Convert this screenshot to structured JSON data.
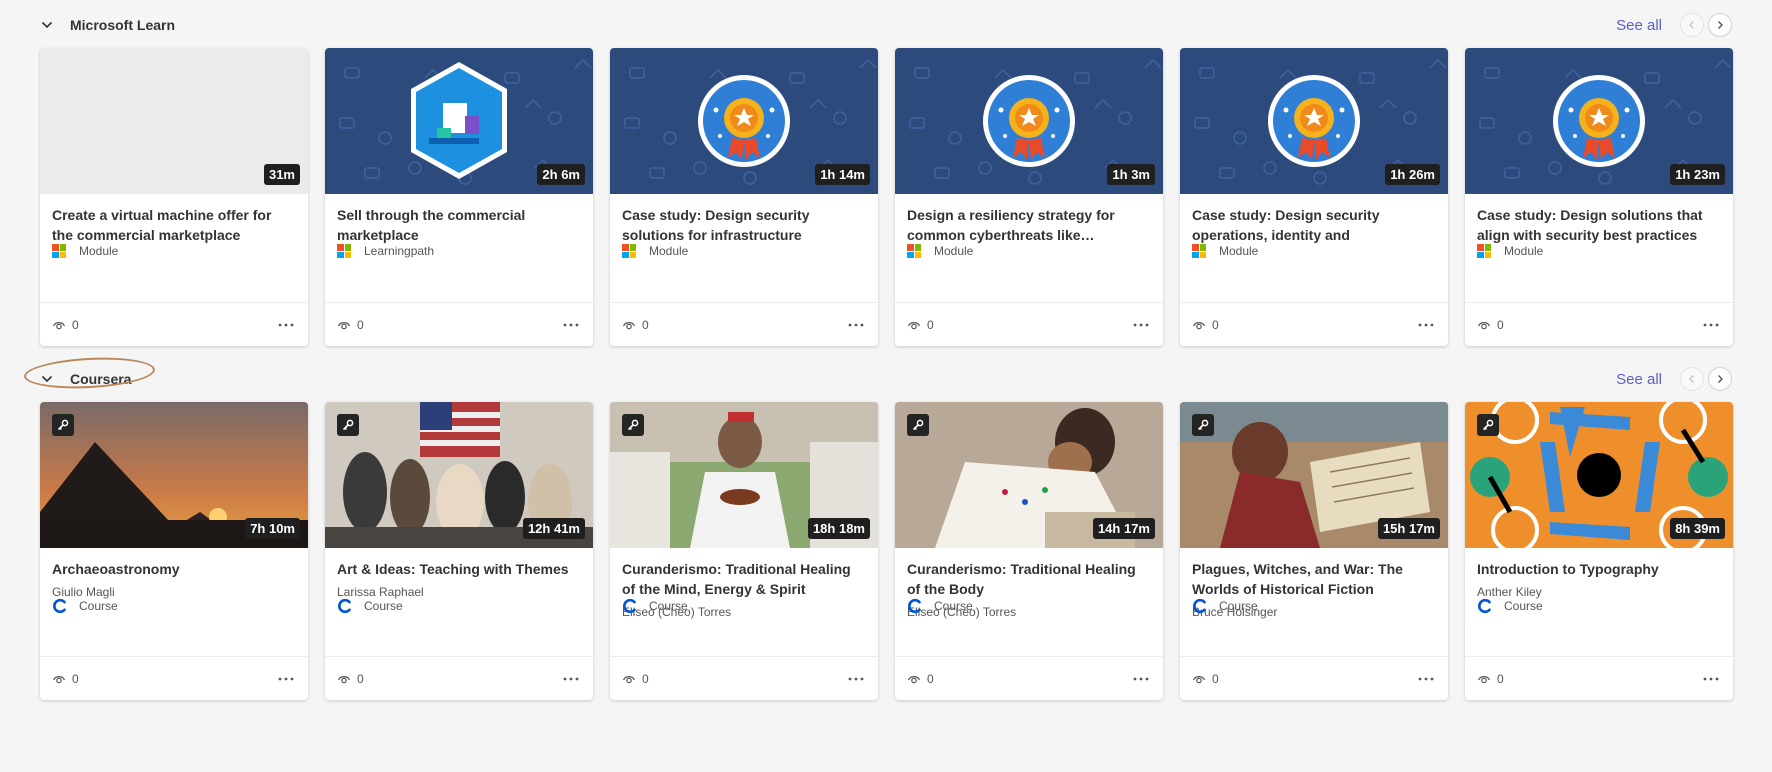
{
  "sections": [
    {
      "title": "Microsoft Learn",
      "see_all": "See all",
      "cards": [
        {
          "title": "Create a virtual machine offer for the commercial marketplace",
          "duration": "31m",
          "type": "Module",
          "views": "0",
          "thumb": "blank"
        },
        {
          "title": "Sell through the commercial marketplace",
          "duration": "2h 6m",
          "type": "Learningpath",
          "views": "0",
          "thumb": "hex-badge"
        },
        {
          "title": "Case study: Design security solutions for infrastructure",
          "duration": "1h 14m",
          "type": "Module",
          "views": "0",
          "thumb": "medal-badge"
        },
        {
          "title": "Design a resiliency strategy for common cyberthreats like…",
          "duration": "1h 3m",
          "type": "Module",
          "views": "0",
          "thumb": "medal-badge"
        },
        {
          "title": "Case study: Design security operations, identity and complianc…",
          "duration": "1h 26m",
          "type": "Module",
          "views": "0",
          "thumb": "medal-badge"
        },
        {
          "title": "Case study: Design solutions that align with security best practices an…",
          "duration": "1h 23m",
          "type": "Module",
          "views": "0",
          "thumb": "medal-badge"
        }
      ]
    },
    {
      "title": "Coursera",
      "see_all": "See all",
      "cards": [
        {
          "title": "Archaeoastronomy",
          "author": "Giulio Magli",
          "duration": "7h 10m",
          "type": "Course",
          "views": "0",
          "thumb": "pyramid-photo"
        },
        {
          "title": "Art & Ideas: Teaching with Themes",
          "author": "Larissa Raphael",
          "duration": "12h 41m",
          "type": "Course",
          "views": "0",
          "thumb": "classroom-photo"
        },
        {
          "title": "Curanderismo: Traditional Healing of the Mind, Energy & Spirit",
          "author": "Eliseo (Cheo) Torres",
          "duration": "18h 18m",
          "type": "Course",
          "views": "0",
          "thumb": "healer-photo"
        },
        {
          "title": "Curanderismo: Traditional Healing of the Body",
          "author": "Eliseo (Cheo) Torres",
          "duration": "14h 17m",
          "type": "Course",
          "views": "0",
          "thumb": "healer-woman-photo"
        },
        {
          "title": "Plagues, Witches, and War: The Worlds of Historical Fiction",
          "author": "Bruce Holsinger",
          "duration": "15h 17m",
          "type": "Course",
          "views": "0",
          "thumb": "manuscript-art"
        },
        {
          "title": "Introduction to Typography",
          "author": "Anther Kiley",
          "duration": "8h 39m",
          "type": "Course",
          "views": "0",
          "thumb": "typography-art"
        }
      ]
    }
  ],
  "colors": {
    "accent": "#5b5fc7",
    "badge_blue": "#2c4a7c",
    "ms_red": "#f25022",
    "ms_green": "#7fba00",
    "ms_blue": "#00a4ef",
    "ms_yellow": "#ffb900",
    "coursera_blue": "#0056d2"
  }
}
